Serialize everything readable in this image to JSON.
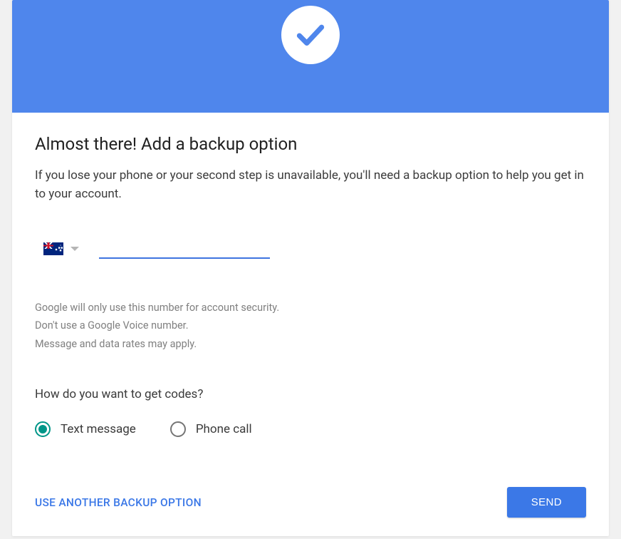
{
  "header": {
    "icon": "checkmark-icon"
  },
  "main": {
    "title": "Almost there! Add a backup option",
    "description": "If you lose your phone or your second step is unavailable, you'll need a backup option to help you get in to your account.",
    "phone": {
      "country": "Australia",
      "value": ""
    },
    "hints": {
      "line1": "Google will only use this number for account security.",
      "line2": "Don't use a Google Voice number.",
      "line3": "Message and data rates may apply."
    },
    "codes_heading": "How do you want to get codes?",
    "options": {
      "text_message": "Text message",
      "phone_call": "Phone call",
      "selected": "text_message"
    }
  },
  "footer": {
    "alt_link": "USE ANOTHER BACKUP OPTION",
    "send_button": "SEND"
  }
}
